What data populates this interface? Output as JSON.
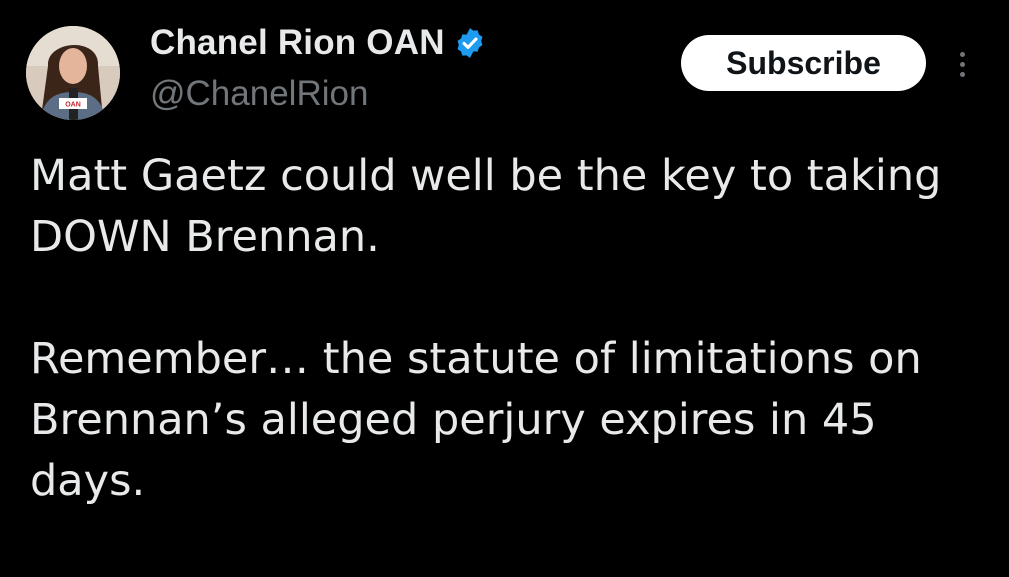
{
  "author": {
    "display_name": "Chanel Rion OAN",
    "handle": "@ChanelRion",
    "verified_icon": "verified-badge-icon",
    "avatar_logo": "OAN"
  },
  "actions": {
    "subscribe_label": "Subscribe",
    "more_icon": "more-options-icon"
  },
  "tweet": {
    "paragraph_1": "Matt Gaetz could well be the key to taking DOWN Brennan.",
    "paragraph_2": "Remember… the statute of limitations on Brennan’s alleged perjury expires in 45 days."
  },
  "colors": {
    "background": "#000000",
    "text": "#e7e9ea",
    "secondary_text": "#71767b",
    "verified_blue": "#1d9bf0",
    "button_bg": "#ffffff"
  }
}
